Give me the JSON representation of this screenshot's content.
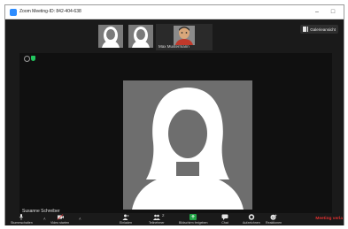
{
  "window": {
    "title": "Zoom Meeting-ID: 842-404-638",
    "minimize_label": "–",
    "maximize_label": "□"
  },
  "thumbnails": [
    {
      "name": ""
    },
    {
      "name": ""
    }
  ],
  "self_view": {
    "name": "Max Mustermann"
  },
  "view_button": {
    "label": "Galerieansicht",
    "icon": "grid-icon"
  },
  "main": {
    "speaker_name": "Susanne Schreiber",
    "security_color": "#22c55e"
  },
  "toolbar": {
    "items": [
      {
        "label": "Stummschalten",
        "icon": "microphone-icon"
      },
      {
        "label": "Video starten",
        "icon": "video-off-icon"
      },
      {
        "label": "Einladen",
        "icon": "invite-icon"
      },
      {
        "label": "Teilnehmer",
        "icon": "participants-icon",
        "count": "2"
      },
      {
        "label": "Bildschirm freigeben",
        "icon": "share-screen-icon"
      },
      {
        "label": "Chat",
        "icon": "chat-icon"
      },
      {
        "label": "Aufzeichnen",
        "icon": "record-icon"
      },
      {
        "label": "Reaktionen",
        "icon": "reactions-icon"
      }
    ],
    "end_label": "Meeting verla",
    "share_color": "#22a447",
    "end_color": "#e02f2f"
  }
}
